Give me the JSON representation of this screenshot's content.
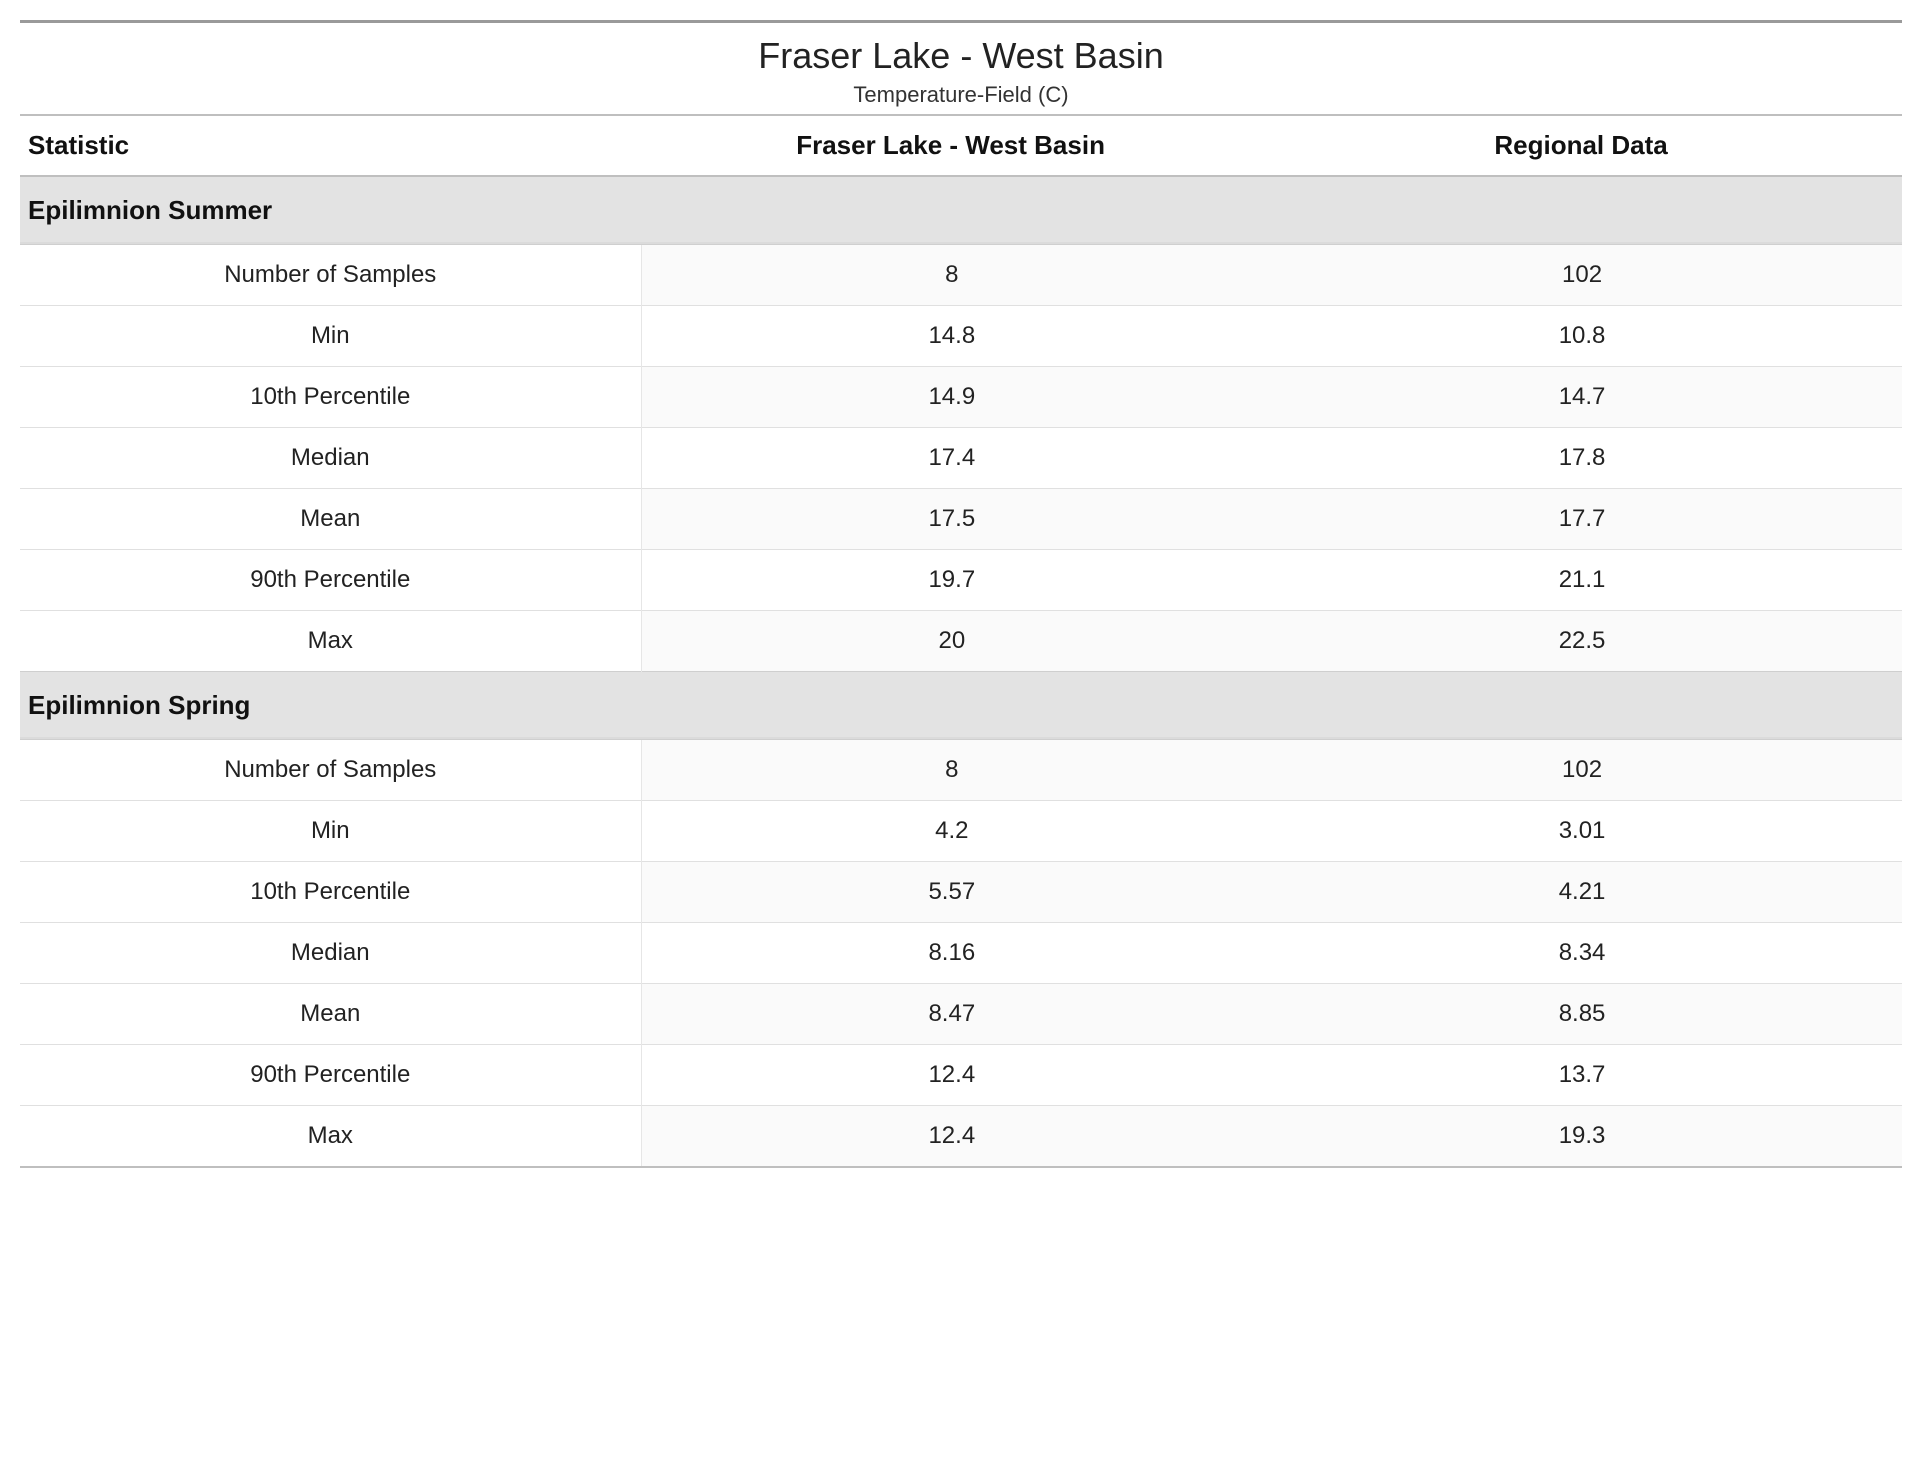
{
  "header": {
    "title": "Fraser Lake - West Basin",
    "subtitle": "Temperature-Field (C)"
  },
  "columns": {
    "stat": "Statistic",
    "site": "Fraser Lake - West Basin",
    "regional": "Regional Data"
  },
  "sections": [
    {
      "name": "Epilimnion Summer",
      "rows": [
        {
          "stat": "Number of Samples",
          "site": "8",
          "regional": "102"
        },
        {
          "stat": "Min",
          "site": "14.8",
          "regional": "10.8"
        },
        {
          "stat": "10th Percentile",
          "site": "14.9",
          "regional": "14.7"
        },
        {
          "stat": "Median",
          "site": "17.4",
          "regional": "17.8"
        },
        {
          "stat": "Mean",
          "site": "17.5",
          "regional": "17.7"
        },
        {
          "stat": "90th Percentile",
          "site": "19.7",
          "regional": "21.1"
        },
        {
          "stat": "Max",
          "site": "20",
          "regional": "22.5"
        }
      ]
    },
    {
      "name": "Epilimnion Spring",
      "rows": [
        {
          "stat": "Number of Samples",
          "site": "8",
          "regional": "102"
        },
        {
          "stat": "Min",
          "site": "4.2",
          "regional": "3.01"
        },
        {
          "stat": "10th Percentile",
          "site": "5.57",
          "regional": "4.21"
        },
        {
          "stat": "Median",
          "site": "8.16",
          "regional": "8.34"
        },
        {
          "stat": "Mean",
          "site": "8.47",
          "regional": "8.85"
        },
        {
          "stat": "90th Percentile",
          "site": "12.4",
          "regional": "13.7"
        },
        {
          "stat": "Max",
          "site": "12.4",
          "regional": "19.3"
        }
      ]
    }
  ],
  "chart_data": {
    "type": "table",
    "title": "Fraser Lake - West Basin — Temperature-Field (C)",
    "series": [
      {
        "name": "Fraser Lake - West Basin",
        "group": "Epilimnion Summer",
        "stats": {
          "Number of Samples": 8,
          "Min": 14.8,
          "10th Percentile": 14.9,
          "Median": 17.4,
          "Mean": 17.5,
          "90th Percentile": 19.7,
          "Max": 20
        }
      },
      {
        "name": "Regional Data",
        "group": "Epilimnion Summer",
        "stats": {
          "Number of Samples": 102,
          "Min": 10.8,
          "10th Percentile": 14.7,
          "Median": 17.8,
          "Mean": 17.7,
          "90th Percentile": 21.1,
          "Max": 22.5
        }
      },
      {
        "name": "Fraser Lake - West Basin",
        "group": "Epilimnion Spring",
        "stats": {
          "Number of Samples": 8,
          "Min": 4.2,
          "10th Percentile": 5.57,
          "Median": 8.16,
          "Mean": 8.47,
          "90th Percentile": 12.4,
          "Max": 12.4
        }
      },
      {
        "name": "Regional Data",
        "group": "Epilimnion Spring",
        "stats": {
          "Number of Samples": 102,
          "Min": 3.01,
          "10th Percentile": 4.21,
          "Median": 8.34,
          "Mean": 8.85,
          "90th Percentile": 13.7,
          "Max": 19.3
        }
      }
    ]
  }
}
